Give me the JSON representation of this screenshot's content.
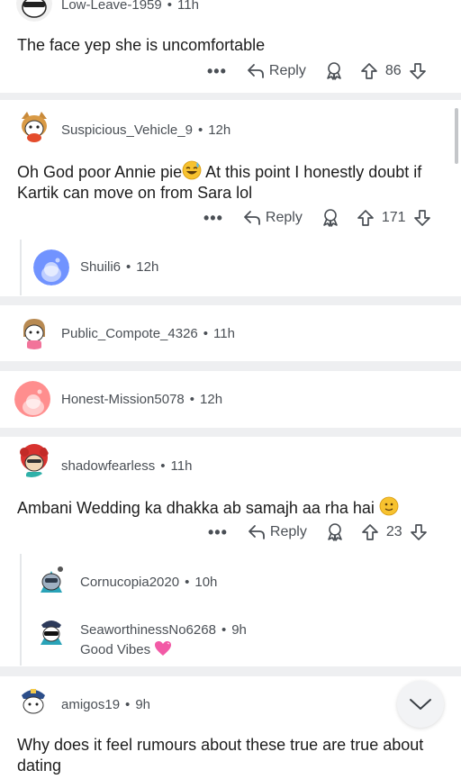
{
  "comments": [
    {
      "user": "Low-Leave-1959",
      "time": "11h",
      "body": "The face yep she is uncomfortable",
      "more": "•••",
      "reply": "Reply",
      "votes": "86"
    },
    {
      "user": "Suspicious_Vehicle_9",
      "time": "12h",
      "body_a": "Oh God poor Annie pie",
      "body_b": " At this point I honestly doubt if Kartik can move on from Sara lol",
      "more": "•••",
      "reply": "Reply",
      "votes": "171"
    },
    {
      "user": "Shuili6",
      "time": "12h"
    },
    {
      "user": "Public_Compote_4326",
      "time": "11h"
    },
    {
      "user": "Honest-Mission5078",
      "time": "12h"
    },
    {
      "user": "shadowfearless",
      "time": "11h",
      "body": "Ambani Wedding ka dhakka ab samajh aa rha hai",
      "more": "•••",
      "reply": "Reply",
      "votes": "23"
    },
    {
      "user": "Cornucopia2020",
      "time": "10h"
    },
    {
      "user": "SeaworthinessNo6268",
      "time": "9h",
      "flair": "Good Vibes"
    },
    {
      "user": "amigos19",
      "time": "9h",
      "body": "Why does it feel rumours about these true are true about dating"
    }
  ],
  "separator": "•",
  "icons": {
    "more": "more-dots-icon",
    "reply": "reply-arrow-icon",
    "award": "award-icon",
    "upvote": "upvote-arrow-icon",
    "downvote": "downvote-arrow-icon",
    "scroll": "chevron-down-icon"
  },
  "colors": {
    "text": "#1c1c1c",
    "meta": "#4a4f55",
    "separator": "#eeeff1"
  }
}
